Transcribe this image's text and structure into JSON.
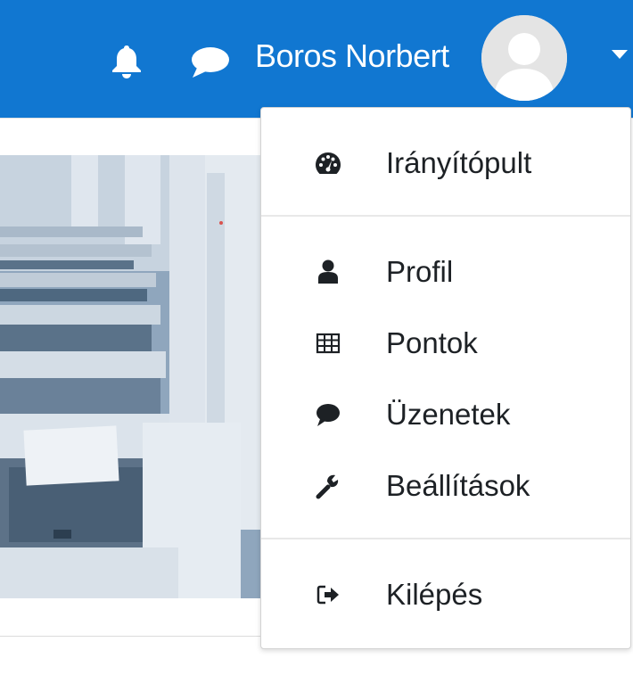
{
  "navbar": {
    "user_name": "Boros Norbert",
    "notifications_icon": "bell-icon",
    "messages_icon": "chat-bubble-icon",
    "avatar_icon": "user-avatar-icon",
    "menu_toggle_icon": "caret-down-icon",
    "background_color": "#1177d1"
  },
  "user_menu": {
    "items": [
      {
        "label": "Irányítópult",
        "icon": "dashboard-gauge-icon"
      },
      {
        "label": "Profil",
        "icon": "user-icon"
      },
      {
        "label": "Pontok",
        "icon": "table-grid-icon"
      },
      {
        "label": "Üzenetek",
        "icon": "comment-icon"
      },
      {
        "label": "Beállítások",
        "icon": "wrench-icon"
      },
      {
        "label": "Kilépés",
        "icon": "sign-out-icon"
      }
    ]
  }
}
